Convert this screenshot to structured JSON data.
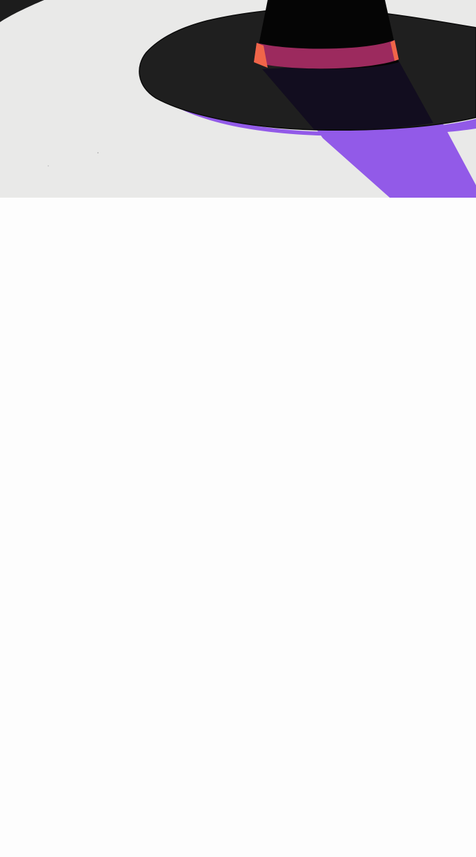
{
  "illustration": {
    "subject": "witch-hat",
    "colors": {
      "background": "#e9e9e8",
      "hat_black": "#050505",
      "brim_dark": "#1f1f1f",
      "brim_shadow": "#120d1f",
      "purple_light": "#925ae8",
      "band_magenta": "#9c2a5e",
      "band_orange": "#f06549",
      "page_white": "#fdfdfd"
    }
  }
}
